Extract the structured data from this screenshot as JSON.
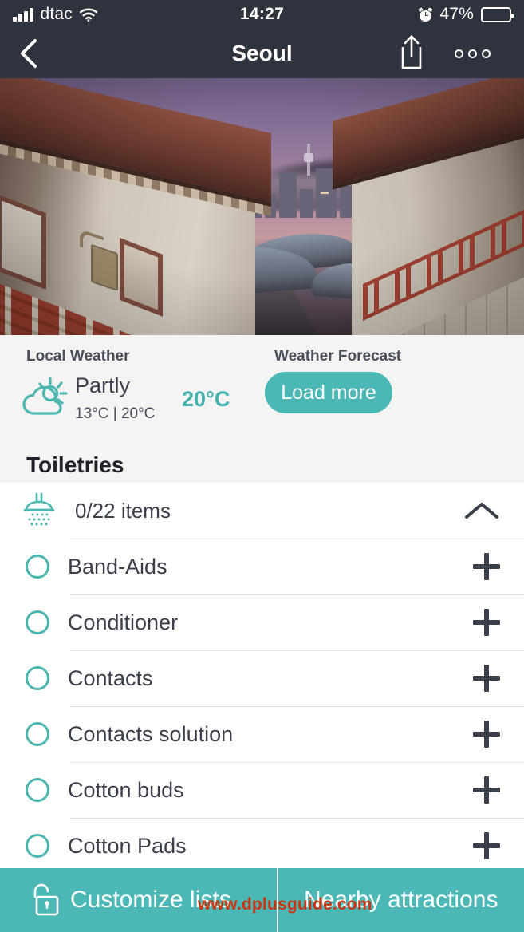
{
  "status_bar": {
    "carrier": "dtac",
    "time": "14:27",
    "battery_percent": "47%",
    "signal_icon": "signal-bars-icon",
    "wifi_icon": "wifi-icon",
    "alarm_icon": "alarm-clock-icon",
    "battery_icon": "battery-icon",
    "battery_level": 47
  },
  "nav": {
    "title": "Seoul",
    "back_icon": "back-chevron-icon",
    "share_icon": "share-icon",
    "more_icon": "more-options-icon"
  },
  "hero": {
    "alt": "Bukchon Hanok Village alley at dusk with Seoul skyline"
  },
  "weather": {
    "local_label": "Local Weather",
    "forecast_label": "Weather Forecast",
    "condition": "Partly",
    "range": "13°C | 20°C",
    "current_temp": "20°C",
    "load_more_label": "Load more",
    "icon": "partly-cloudy-icon",
    "accent_color": "#4BB8B5",
    "temp_color": "#43B1AE"
  },
  "section": {
    "title": "Toiletries",
    "header": {
      "icon": "shower-icon",
      "count_label": "0/22 items",
      "collapse_icon": "chevron-up-icon"
    },
    "items": [
      {
        "label": "Band-Aids",
        "checked": false
      },
      {
        "label": "Conditioner",
        "checked": false
      },
      {
        "label": "Contacts",
        "checked": false
      },
      {
        "label": "Contacts solution",
        "checked": false
      },
      {
        "label": "Cotton buds",
        "checked": false
      },
      {
        "label": "Cotton Pads",
        "checked": false
      }
    ]
  },
  "bottom_bar": {
    "customize_label": "Customize lists",
    "nearby_label": "Nearby attractions",
    "lock_icon": "open-padlock-icon",
    "background_color": "#4BB8B5"
  },
  "watermark": {
    "text": "www.dplusguide.com",
    "color": "#CC3311"
  }
}
